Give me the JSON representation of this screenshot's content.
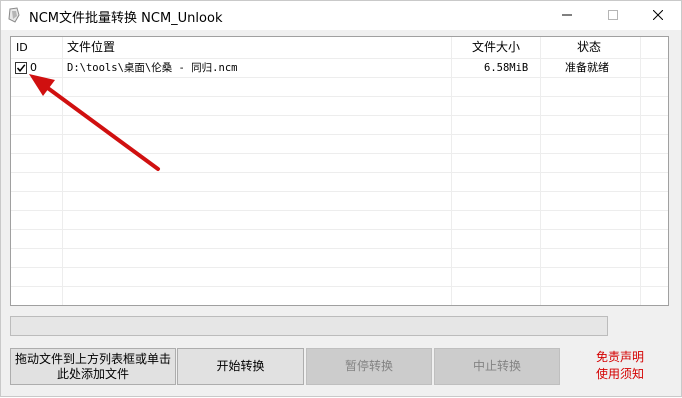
{
  "window": {
    "title": "NCM文件批量转换 NCM_Unlook"
  },
  "table": {
    "columns": [
      "ID",
      "文件位置",
      "文件大小",
      "状态"
    ],
    "rows": [
      {
        "checked": true,
        "id": "0",
        "path": "D:\\tools\\桌面\\伦桑 - 同归.ncm",
        "size": "6.58MiB",
        "status": "准备就绪"
      }
    ]
  },
  "progress": {
    "value": 0
  },
  "buttons": {
    "add_files": "拖动文件到上方列表框或单击此处添加文件",
    "start": "开始转换",
    "pause": "暂停转换",
    "stop": "中止转换"
  },
  "notice": {
    "line1": "免责声明",
    "line2": "使用须知"
  },
  "colors": {
    "annotation_arrow": "#d01010",
    "notice_text": "#d40000"
  }
}
